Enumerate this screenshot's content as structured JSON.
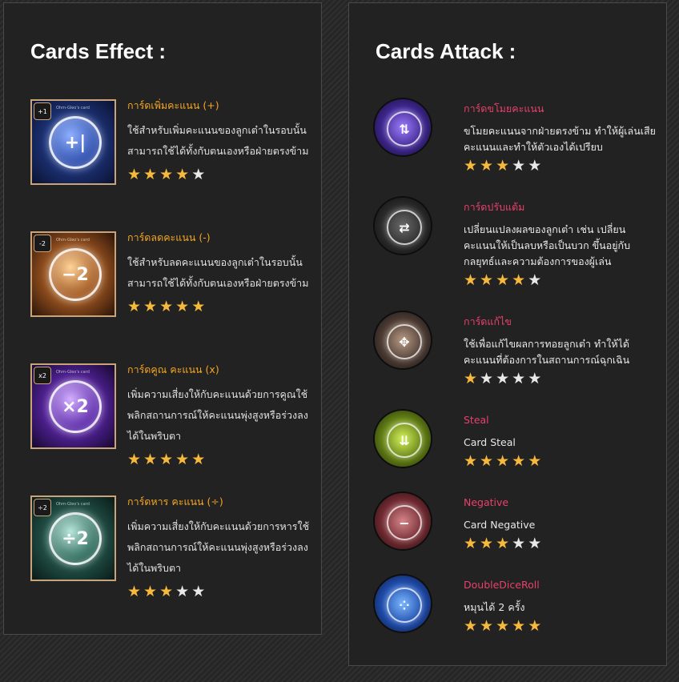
{
  "effect_panel": {
    "title": "Cards Effect :",
    "cards": [
      {
        "badge": "+1",
        "caption": "Ohm-Gleo's card",
        "symbol": "+|",
        "name": "การ์ดเพิ่มคะแนน (+)",
        "desc": "ใช้สำหรับเพิ่มคะแนนของลูกเต๋าในรอบนั้น สามารถใช้ได้ทั้งกับตนเองหรือฝ่ายตรงข้าม",
        "rating": 4,
        "theme": "blue"
      },
      {
        "badge": "-2",
        "caption": "Ohm-Gleo's card",
        "symbol": "−2",
        "name": "การ์ดลดคะแนน (-)",
        "desc": "ใช้สำหรับลดคะแนนของลูกเต๋าในรอบนั้น สามารถใช้ได้ทั้งกับตนเองหรือฝ่ายตรงข้าม",
        "rating": 5,
        "theme": "orange"
      },
      {
        "badge": "x2",
        "caption": "Ohm-Gleo's card",
        "symbol": "×2",
        "name": "การ์ดคูณ คะแนน (x)",
        "desc": "เพิ่มความเสี่ยงให้กับคะแนนด้วยการคูณใช้พลิกสถานการณ์ให้คะแนนพุ่งสูงหรือร่วงลงได้ในพริบตา",
        "rating": 5,
        "theme": "purple"
      },
      {
        "badge": "÷2",
        "caption": "Ohm-Gleo's card",
        "symbol": "÷2",
        "name": "การ์ดหาร คะแนน (÷)",
        "desc": "เพิ่มความเสี่ยงให้กับคะแนนด้วยการหารใช้พลิกสถานการณ์ให้คะแนนพุ่งสูงหรือร่วงลงได้ในพริบตา",
        "rating": 3,
        "theme": "teal"
      }
    ]
  },
  "attack_panel": {
    "title": "Cards Attack :",
    "cards": [
      {
        "symbol": "⇅",
        "name": "การ์ดขโมยคะแนน",
        "desc": "ขโมยคะแนนจากฝ่ายตรงข้าม ทำให้ผู้เล่นเสียคะแนนและทำให้ตัวเองได้เปรียบ",
        "rating": 3,
        "theme": "violet"
      },
      {
        "symbol": "⇄",
        "name": "การ์ดปรับแต้ม",
        "desc": "เปลี่ยนแปลงผลของลูกเต๋า เช่น เปลี่ยนคะแนนให้เป็นลบหรือเป็นบวก ขึ้นอยู่กับกลยุทธ์และความต้องการของผู้เล่น",
        "rating": 4,
        "theme": "dark"
      },
      {
        "symbol": "✥",
        "name": "การ์ดแก้ไข",
        "desc": "ใช้เพื่อแก้ไขผลการทอยลูกเต๋า ทำให้ได้คะแนนที่ต้องการในสถานการณ์ฉุกเฉิน",
        "rating": 1,
        "theme": "bronze"
      },
      {
        "symbol": "⇊",
        "name": "Steal",
        "desc": "Card Steal",
        "rating": 5,
        "theme": "lime"
      },
      {
        "symbol": "−",
        "name": "Negative",
        "desc": "Card Negative",
        "rating": 3,
        "theme": "maroon"
      },
      {
        "symbol": "⁘",
        "name": "DoubleDiceRoll",
        "desc": "หมุนได้ 2 ครั้ง",
        "rating": 5,
        "theme": "azure"
      }
    ]
  },
  "colors": {
    "effect_name": "#f5a623",
    "attack_name": "#e8416b",
    "star_on": "#f6b93b",
    "star_off": "#e8e8e8"
  }
}
